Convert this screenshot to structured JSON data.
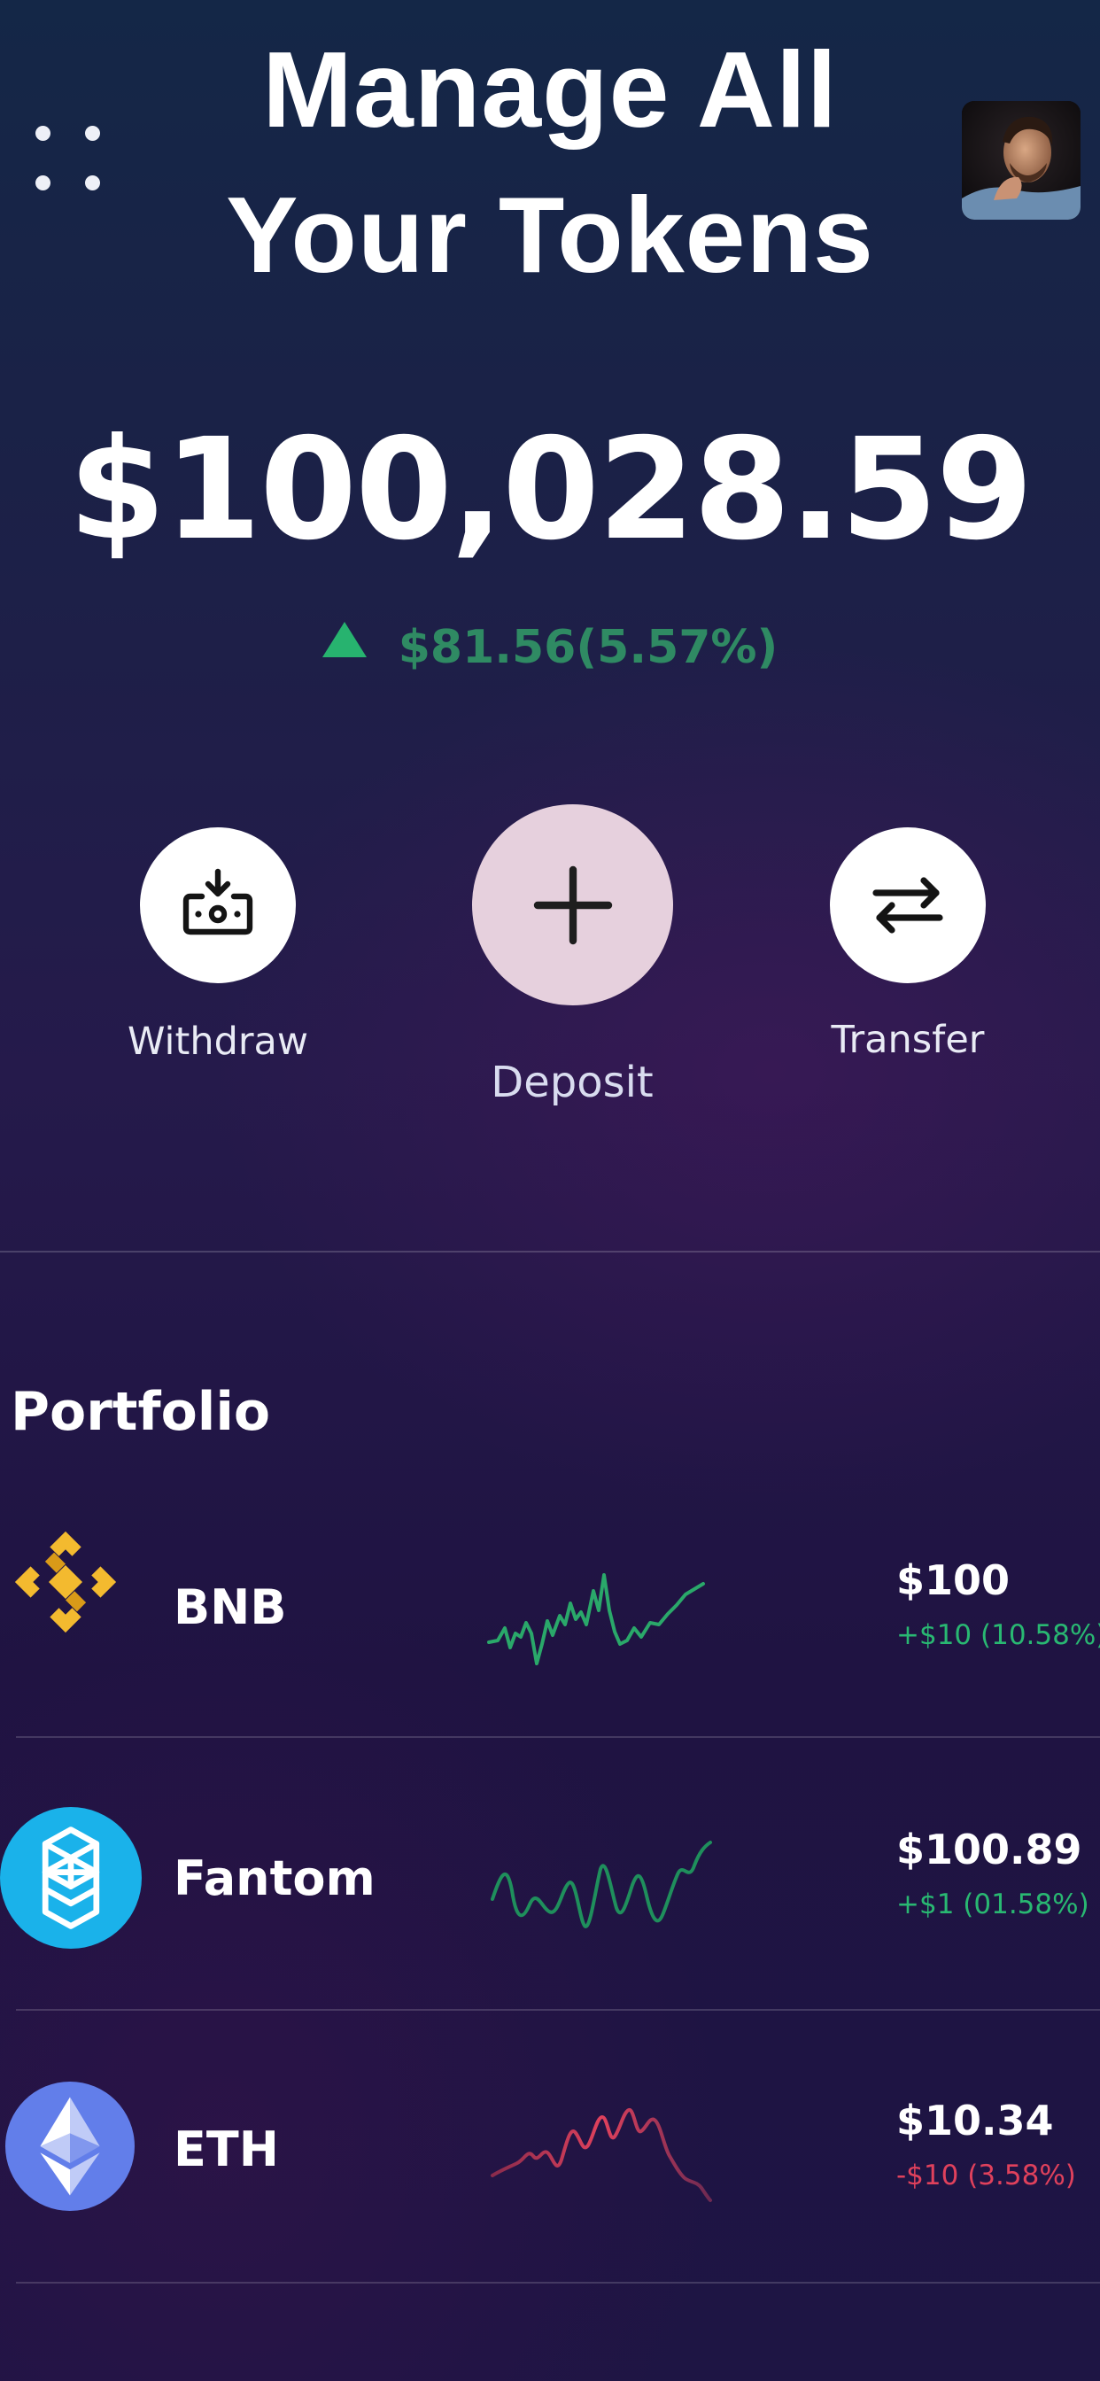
{
  "header": {
    "title_line1": "Manage All",
    "title_line2": "Your Tokens",
    "menu_icon": "grid-dots-icon",
    "avatar_icon": "user-avatar"
  },
  "balance": {
    "total": "$100,028.59",
    "change": "$81.56(5.57%)",
    "direction": "up",
    "change_color": "#2f8a63"
  },
  "actions": [
    {
      "label": "Withdraw",
      "icon": "withdraw-icon"
    },
    {
      "label": "Deposit",
      "icon": "plus-icon"
    },
    {
      "label": "Transfer",
      "icon": "transfer-arrows-icon"
    }
  ],
  "portfolio": {
    "title": "Portfolio",
    "tokens": [
      {
        "name": "BNB",
        "value": "$100",
        "change": "+$10 (10.58%)",
        "trend": "up",
        "icon": "bnb-logo-icon"
      },
      {
        "name": "Fantom",
        "value": "$100.89",
        "change": "+$1 (01.58%)",
        "trend": "up",
        "icon": "fantom-logo-icon"
      },
      {
        "name": "ETH",
        "value": "$10.34",
        "change": "-$10 (3.58%)",
        "trend": "down",
        "icon": "eth-logo-icon"
      }
    ]
  },
  "colors": {
    "positive": "#29b872",
    "negative": "#e0415c",
    "deposit_button": "#e6d0dd"
  }
}
